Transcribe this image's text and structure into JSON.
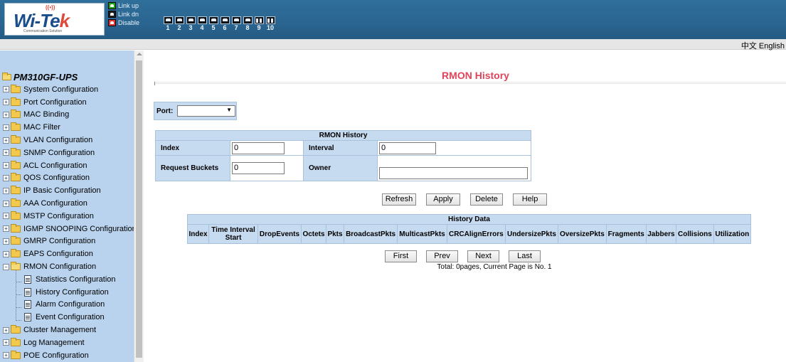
{
  "header": {
    "logo_text": "Wi-Tek",
    "logo_tagline": "Communication Solution",
    "legend": [
      {
        "label": "Link up",
        "color": "#19a319"
      },
      {
        "label": "Link dn",
        "color": "#1f1f1f"
      },
      {
        "label": "Disable",
        "color": "#e03030"
      }
    ],
    "ports": [
      "1",
      "2",
      "3",
      "4",
      "5",
      "6",
      "7",
      "8",
      "9",
      "10"
    ],
    "language": "中文  English"
  },
  "sidebar": {
    "root": "PM310GF-UPS",
    "items": [
      {
        "label": "System Configuration",
        "type": "folder",
        "expander": "+"
      },
      {
        "label": "Port Configuration",
        "type": "folder",
        "expander": "+"
      },
      {
        "label": "MAC Binding",
        "type": "folder",
        "expander": "+"
      },
      {
        "label": "MAC Filter",
        "type": "folder",
        "expander": "+"
      },
      {
        "label": "VLAN Configuration",
        "type": "folder",
        "expander": "+"
      },
      {
        "label": "SNMP Configuration",
        "type": "folder",
        "expander": "+"
      },
      {
        "label": "ACL Configuration",
        "type": "folder",
        "expander": "+"
      },
      {
        "label": "QOS Configuration",
        "type": "folder",
        "expander": "+"
      },
      {
        "label": "IP Basic Configuration",
        "type": "folder",
        "expander": "+"
      },
      {
        "label": "AAA Configuration",
        "type": "folder",
        "expander": "+"
      },
      {
        "label": "MSTP Configuration",
        "type": "folder",
        "expander": "+"
      },
      {
        "label": "IGMP SNOOPING Configuration",
        "type": "folder",
        "expander": "+"
      },
      {
        "label": "GMRP Configuration",
        "type": "folder",
        "expander": "+"
      },
      {
        "label": "EAPS Configuration",
        "type": "folder",
        "expander": "+"
      },
      {
        "label": "RMON Configuration",
        "type": "folder-open",
        "expander": "−"
      },
      {
        "label": "Statistics Configuration",
        "type": "page"
      },
      {
        "label": "History Configuration",
        "type": "page"
      },
      {
        "label": "Alarm Configuration",
        "type": "page"
      },
      {
        "label": "Event Configuration",
        "type": "page"
      },
      {
        "label": "Cluster Management",
        "type": "folder",
        "expander": "+"
      },
      {
        "label": "Log Management",
        "type": "folder",
        "expander": "+"
      },
      {
        "label": "POE Configuration",
        "type": "folder",
        "expander": "+"
      }
    ]
  },
  "main": {
    "title": "RMON History",
    "port_label": "Port:",
    "port_value": "",
    "config": {
      "header": "RMON History",
      "index_label": "Index",
      "index_value": "0",
      "interval_label": "Interval",
      "interval_value": "0",
      "buckets_label": "Request Buckets",
      "buckets_value": "0",
      "owner_label": "Owner",
      "owner_value": ""
    },
    "buttons": {
      "refresh": "Refresh",
      "apply": "Apply",
      "delete": "Delete",
      "help": "Help"
    },
    "history": {
      "header": "History Data",
      "columns": [
        "Index",
        "Time Interval Start",
        "DropEvents",
        "Octets",
        "Pkts",
        "BroadcastPkts",
        "MulticastPkts",
        "CRCAlignErrors",
        "UndersizePkts",
        "OversizePkts",
        "Fragments",
        "Jabbers",
        "Collisions",
        "Utilization"
      ]
    },
    "pager": {
      "first": "First",
      "prev": "Prev",
      "next": "Next",
      "last": "Last",
      "info": "Total: 0pages, Current Page is No. 1"
    }
  }
}
